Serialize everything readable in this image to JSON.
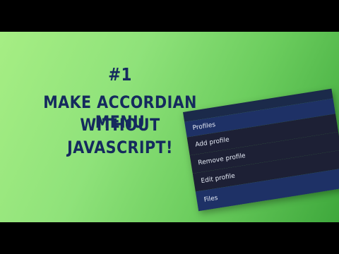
{
  "headline": {
    "number": "#1",
    "line1": "MAKE ACCORDIAN MENU",
    "line2": "WITHOUT",
    "line3": "JAVASCRIPT!"
  },
  "menu": {
    "profiles_label": "Profiles",
    "sub_items": [
      "Add profile",
      "Remove profile",
      "Edit profile"
    ],
    "files_label": "Files"
  },
  "colors": {
    "headline": "#152a5e",
    "menu_header": "#1e3166",
    "menu_body": "#1d2035"
  }
}
